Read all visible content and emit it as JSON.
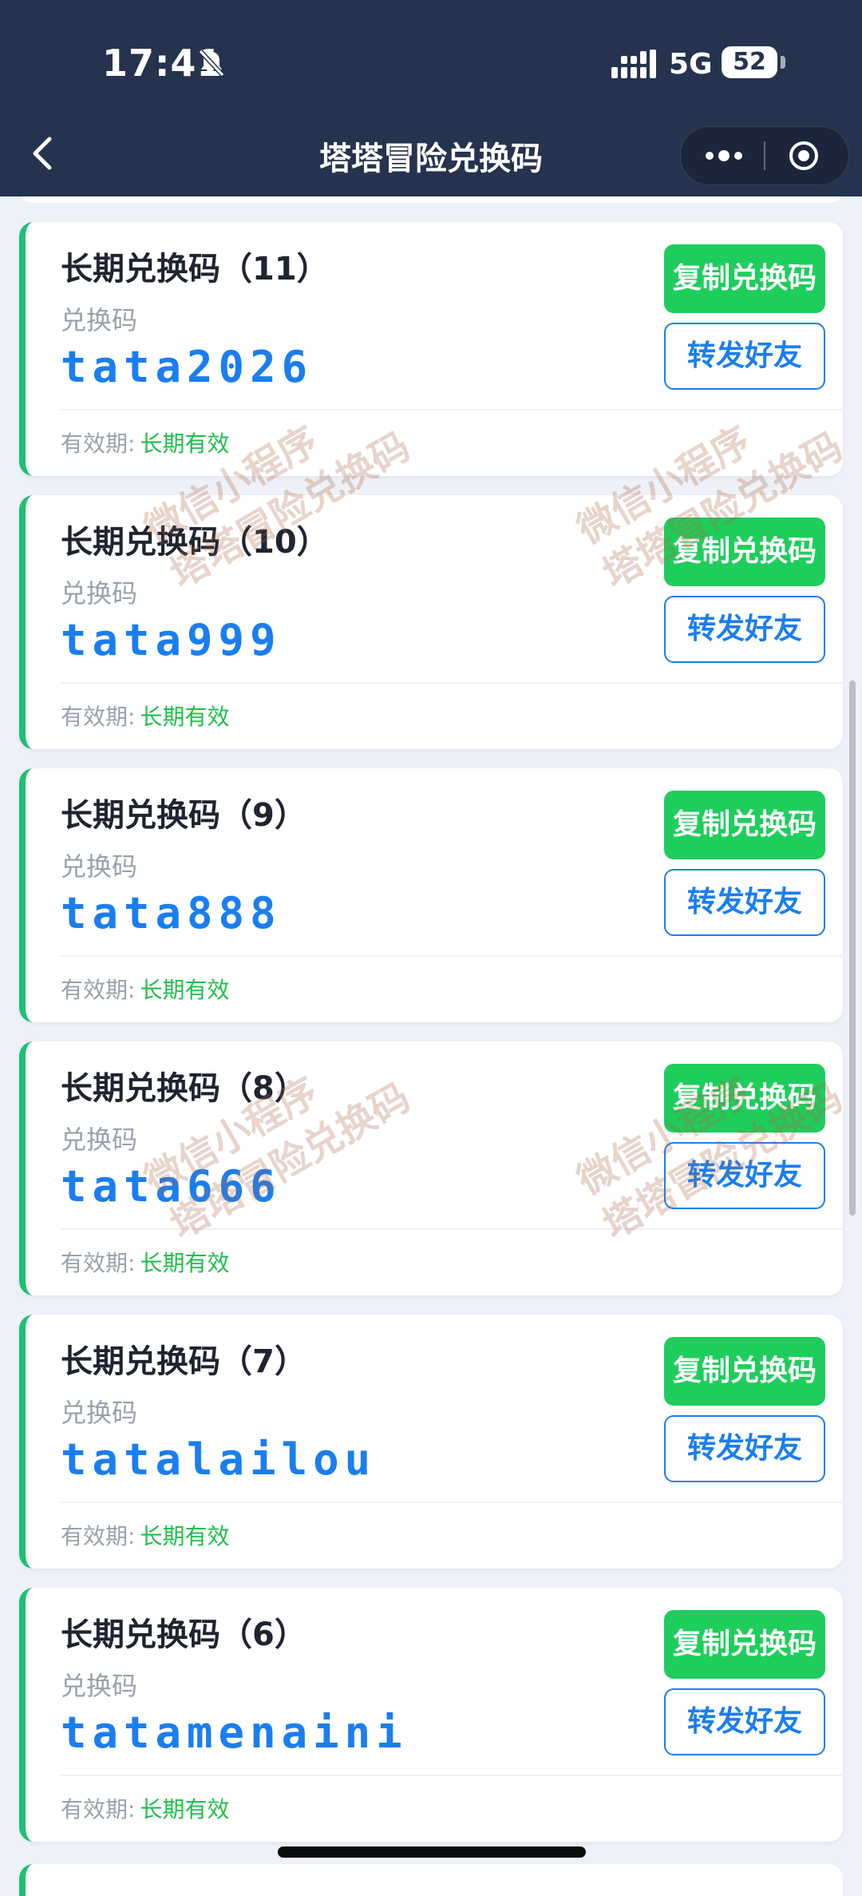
{
  "status_bar": {
    "time": "17:41",
    "network": "5G",
    "battery": "52"
  },
  "nav": {
    "title": "塔塔冒险兑换码"
  },
  "cards": [
    {
      "title": "长期兑换码（11）",
      "sub_label": "兑换码",
      "code": "tata2026",
      "valid_label": "有效期:",
      "valid_value": "长期有效",
      "copy_label": "复制兑换码",
      "share_label": "转发好友"
    },
    {
      "title": "长期兑换码（10）",
      "sub_label": "兑换码",
      "code": "tata999",
      "valid_label": "有效期:",
      "valid_value": "长期有效",
      "copy_label": "复制兑换码",
      "share_label": "转发好友"
    },
    {
      "title": "长期兑换码（9）",
      "sub_label": "兑换码",
      "code": "tata888",
      "valid_label": "有效期:",
      "valid_value": "长期有效",
      "copy_label": "复制兑换码",
      "share_label": "转发好友"
    },
    {
      "title": "长期兑换码（8）",
      "sub_label": "兑换码",
      "code": "tata666",
      "valid_label": "有效期:",
      "valid_value": "长期有效",
      "copy_label": "复制兑换码",
      "share_label": "转发好友"
    },
    {
      "title": "长期兑换码（7）",
      "sub_label": "兑换码",
      "code": "tatalailou",
      "valid_label": "有效期:",
      "valid_value": "长期有效",
      "copy_label": "复制兑换码",
      "share_label": "转发好友"
    },
    {
      "title": "长期兑换码（6）",
      "sub_label": "兑换码",
      "code": "tatamenaini",
      "valid_label": "有效期:",
      "valid_value": "长期有效",
      "copy_label": "复制兑换码",
      "share_label": "转发好友"
    }
  ],
  "watermark": {
    "line1": "微信小程序",
    "line2": "塔塔冒险兑换码"
  },
  "colors": {
    "header_bg": "#26334f",
    "accent_green": "#1fcd5c",
    "accent_blue": "#1a7ef0",
    "card_border": "#1fbf74"
  },
  "icons": [
    "back-icon",
    "more-icon",
    "target-icon",
    "bell-muted-icon",
    "signal-icon"
  ]
}
